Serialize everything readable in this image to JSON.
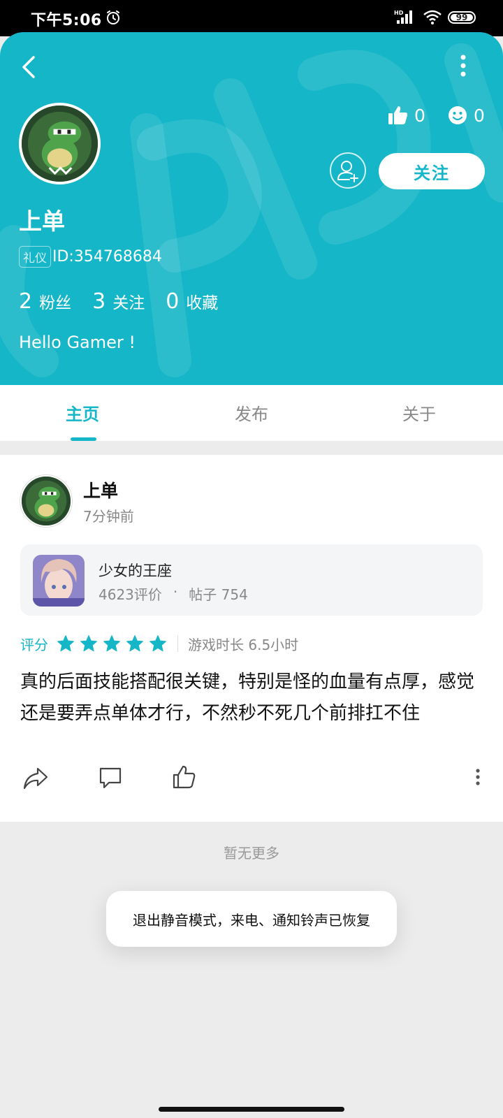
{
  "status_bar": {
    "time": "下午5:06",
    "battery_level": 99,
    "battery_text": "99"
  },
  "profile": {
    "name": "上单",
    "title_badge": "礼仪",
    "user_id": "ID:354768684",
    "likes": "0",
    "emoji_count": "0",
    "follow_label": "关注",
    "counts": [
      {
        "num": "2",
        "label": "粉丝"
      },
      {
        "num": "3",
        "label": "关注"
      },
      {
        "num": "0",
        "label": "收藏"
      }
    ],
    "bio": "Hello Gamer !"
  },
  "colors": {
    "accent": "#15b6c8",
    "star": "#15b6c8"
  },
  "tabs": [
    {
      "label": "主页",
      "active": true
    },
    {
      "label": "发布",
      "active": false
    },
    {
      "label": "关于",
      "active": false
    }
  ],
  "post": {
    "author": "上单",
    "time": "7分钟前",
    "game": {
      "name": "少女的王座",
      "reviews": "4623评价",
      "separator": "·",
      "posts": "帖子 754"
    },
    "rating_label": "评分",
    "stars": 5,
    "playtime": "游戏时长 6.5小时",
    "body": "真的后面技能搭配很关键，特别是怪的血量有点厚，感觉还是要弄点单体才行，不然秒不死几个前排扛不住"
  },
  "footer": {
    "no_more": "暂无更多"
  },
  "toast": {
    "message": "退出静音模式，来电、通知铃声已恢复"
  }
}
